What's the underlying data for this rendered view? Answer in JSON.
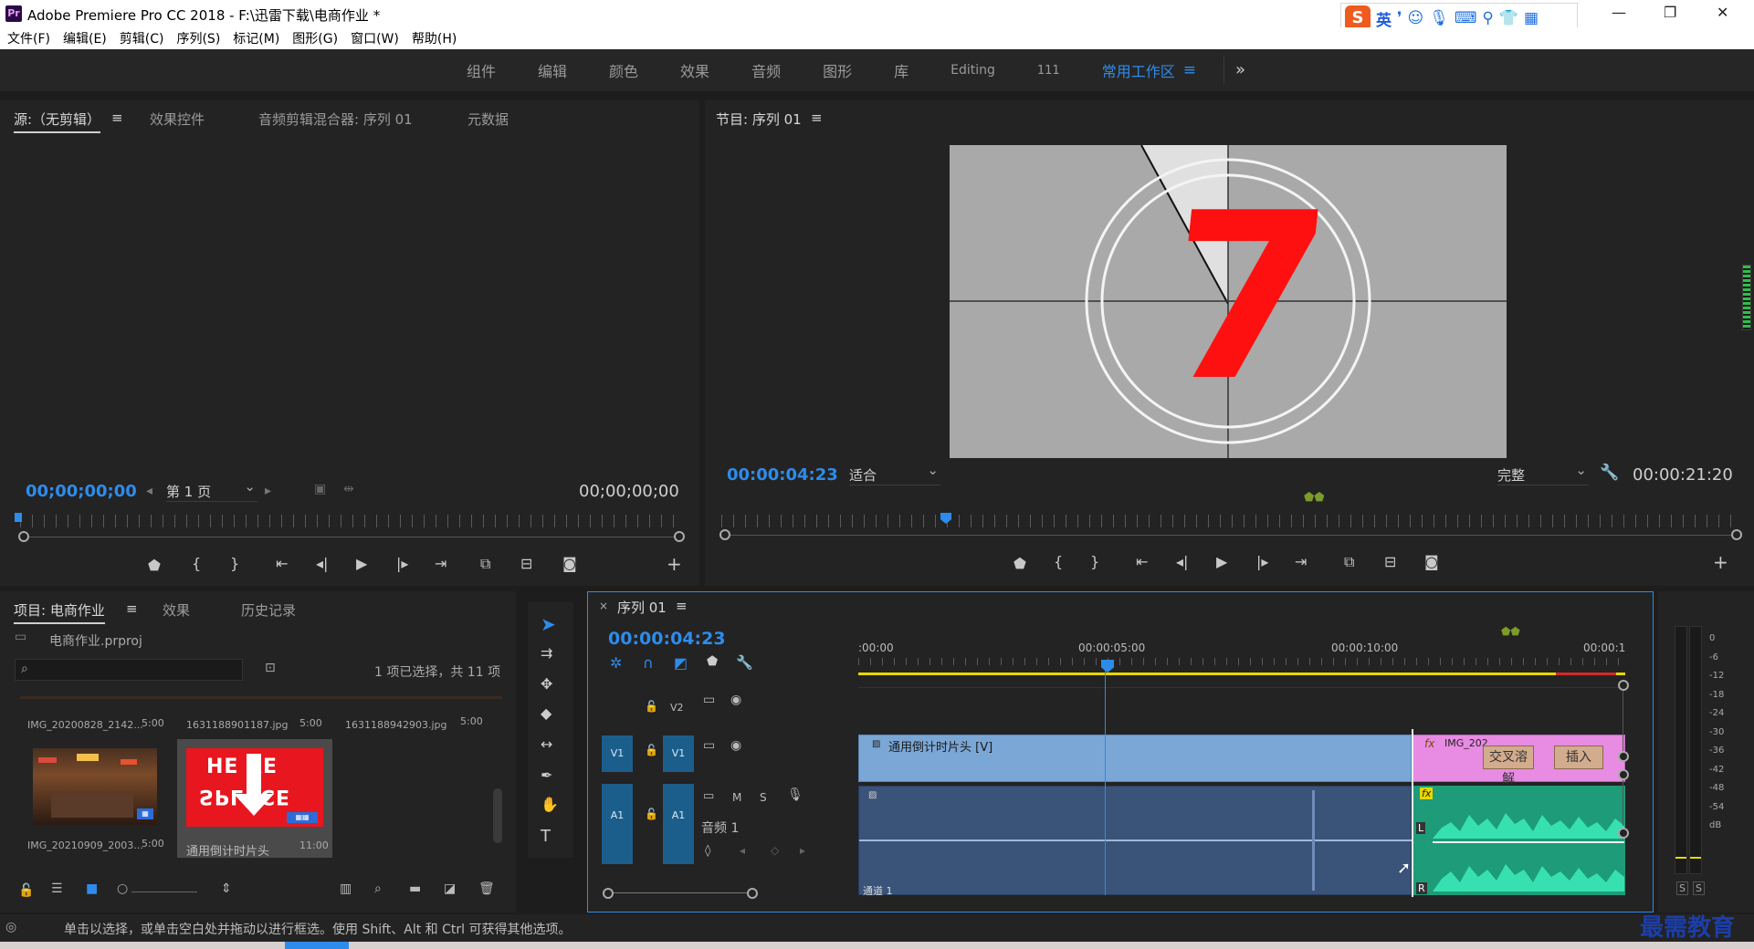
{
  "window": {
    "app_icon": "Pr",
    "title": "Adobe Premiere Pro CC 2018 - F:\\迅雷下载\\电商作业 *",
    "ime_logo": "S",
    "ime_lang": "英"
  },
  "menu": [
    "文件(F)",
    "编辑(E)",
    "剪辑(C)",
    "序列(S)",
    "标记(M)",
    "图形(G)",
    "窗口(W)",
    "帮助(H)"
  ],
  "workspace": {
    "tabs": [
      "组件",
      "编辑",
      "颜色",
      "效果",
      "音频",
      "图形",
      "库",
      "Editing",
      "111",
      "常用工作区"
    ],
    "active": "常用工作区",
    "more": "»"
  },
  "source_panel": {
    "tabs": [
      "源:（无剪辑）",
      "效果控件",
      "音频剪辑混合器: 序列 01",
      "元数据"
    ],
    "timecode_in": "00;00;00;00",
    "page": "第 1 页",
    "timecode_out": "00;00;00;00"
  },
  "program_panel": {
    "tab": "节目: 序列 01",
    "timecode": "00:00:04:23",
    "fit": "适合",
    "quality": "完整",
    "duration": "00:00:21:20",
    "countdown_number": "7"
  },
  "project_panel": {
    "tabs": [
      "项目: 电商作业",
      "效果",
      "历史记录"
    ],
    "project_file": "电商作业.prproj",
    "selection_info": "1 项已选择，共 11 项",
    "items": [
      {
        "name": "IMG_20200828_2142...",
        "duration": "5:00"
      },
      {
        "name": "1631188901187.jpg",
        "duration": "5:00"
      },
      {
        "name": "1631188942903.jpg",
        "duration": "5:00"
      },
      {
        "name": "IMG_20210909_2003...",
        "duration": "5:00"
      },
      {
        "name": "通用倒计时片头",
        "duration": "11:00"
      }
    ],
    "thumb_text_top": "HE RE",
    "thumb_text_bottom": "SPL ICE"
  },
  "timeline": {
    "tab": "序列 01",
    "timecode": "00:00:04:23",
    "ruler_labels": [
      ":00:00",
      "00:00:05:00",
      "00:00:10:00",
      "00:00:1"
    ],
    "tracks": {
      "v2": "V2",
      "v1_src": "V1",
      "v1": "V1",
      "a1_src": "A1",
      "a1": "A1",
      "audio_name": "音频 1",
      "mute": "M",
      "solo": "S"
    },
    "clips": {
      "countdown": "通用倒计时片头 [V]",
      "img": "IMG_202",
      "trans1": "交叉溶解",
      "trans2": "插入",
      "channel": "通道 1",
      "fx": "fx",
      "left_ch": "L",
      "right_ch": "R"
    }
  },
  "meter": {
    "scale": [
      "0",
      "-6",
      "-12",
      "-18",
      "-24",
      "-30",
      "-36",
      "-42",
      "-48",
      "-54",
      "dB"
    ],
    "solo_left": "S",
    "solo_right": "S"
  },
  "status": "单击以选择，或单击空白处并拖动以进行框选。使用 Shift、Alt 和 Ctrl 可获得其他选项。",
  "watermark": "最需教育"
}
